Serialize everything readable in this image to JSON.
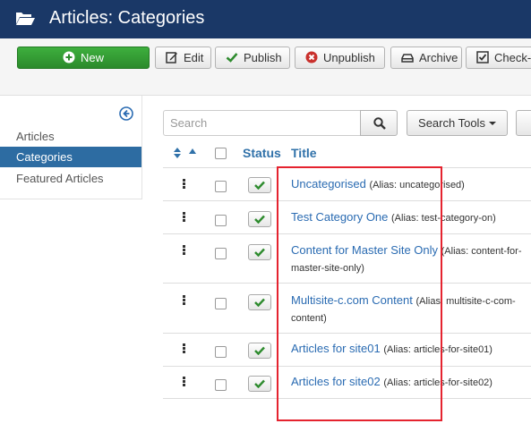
{
  "header": {
    "title": "Articles: Categories"
  },
  "toolbar": {
    "new": "New",
    "edit": "Edit",
    "publish": "Publish",
    "unpublish": "Unpublish",
    "archive": "Archive",
    "checkin": "Check-i"
  },
  "sidebar": {
    "items": [
      {
        "label": "Articles",
        "active": false
      },
      {
        "label": "Categories",
        "active": true
      },
      {
        "label": "Featured Articles",
        "active": false
      }
    ]
  },
  "search": {
    "placeholder": "Search",
    "tools_label": "Search Tools"
  },
  "table": {
    "headers": {
      "status": "Status",
      "title": "Title"
    },
    "rows": [
      {
        "title": "Uncategorised",
        "alias": "(Alias: uncategorised)"
      },
      {
        "title": "Test Category One",
        "alias": "(Alias: test-category-on)"
      },
      {
        "title": "Content for Master Site Only",
        "alias": "(Alias: content-for-master-site-only)"
      },
      {
        "title": "Multisite-c.com Content",
        "alias": "(Alias: multisite-c-com-content)"
      },
      {
        "title": "Articles for site01",
        "alias": "(Alias: articles-for-site01)"
      },
      {
        "title": "Articles for site02",
        "alias": "(Alias: articles-for-site02)"
      }
    ]
  },
  "colors": {
    "header_bg": "#1a3867",
    "new_button": "#3eaf3e",
    "active_nav": "#2d6ca2",
    "link": "#2a6bb2",
    "highlight": "#e5232f"
  }
}
